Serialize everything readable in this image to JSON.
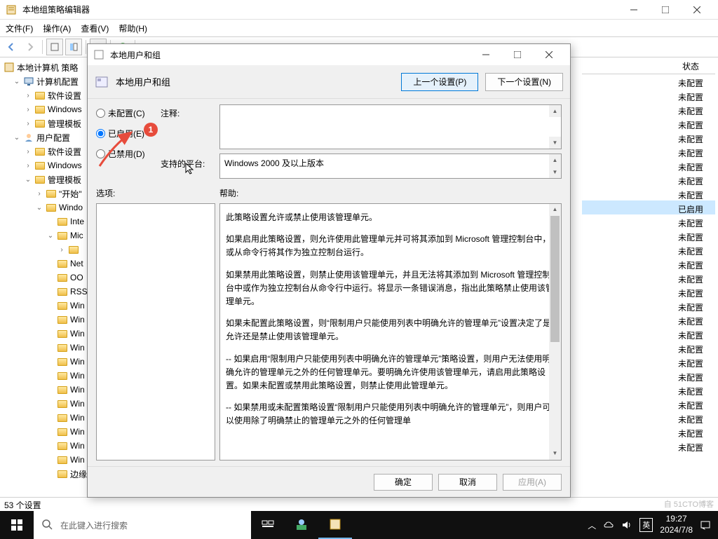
{
  "mainWindow": {
    "title": "本地组策略编辑器",
    "menus": [
      "文件(F)",
      "操作(A)",
      "查看(V)",
      "帮助(H)"
    ]
  },
  "tree": {
    "root": "本地计算机 策略",
    "items": [
      {
        "ind": 1,
        "toggle": "v",
        "icon": "computer",
        "label": "计算机配置"
      },
      {
        "ind": 2,
        "toggle": ">",
        "icon": "folder",
        "label": "软件设置"
      },
      {
        "ind": 2,
        "toggle": ">",
        "icon": "folder",
        "label": "Windows"
      },
      {
        "ind": 2,
        "toggle": ">",
        "icon": "folder",
        "label": "管理模板"
      },
      {
        "ind": 1,
        "toggle": "v",
        "icon": "user",
        "label": "用户配置"
      },
      {
        "ind": 2,
        "toggle": ">",
        "icon": "folder",
        "label": "软件设置"
      },
      {
        "ind": 2,
        "toggle": ">",
        "icon": "folder",
        "label": "Windows"
      },
      {
        "ind": 2,
        "toggle": "v",
        "icon": "folder",
        "label": "管理模板"
      },
      {
        "ind": 3,
        "toggle": ">",
        "icon": "folder",
        "label": "\"开始\""
      },
      {
        "ind": 3,
        "toggle": "v",
        "icon": "folder",
        "label": "Windo"
      },
      {
        "ind": 4,
        "toggle": "",
        "icon": "folder",
        "label": "Inte"
      },
      {
        "ind": 4,
        "toggle": "v",
        "icon": "folder",
        "label": "Mic"
      },
      {
        "ind": 5,
        "toggle": ">",
        "icon": "folder",
        "label": ""
      },
      {
        "ind": 4,
        "toggle": "",
        "icon": "folder",
        "label": "Net"
      },
      {
        "ind": 4,
        "toggle": "",
        "icon": "folder",
        "label": "OO"
      },
      {
        "ind": 4,
        "toggle": "",
        "icon": "folder",
        "label": "RSS"
      },
      {
        "ind": 4,
        "toggle": "",
        "icon": "folder",
        "label": "Win"
      },
      {
        "ind": 4,
        "toggle": "",
        "icon": "folder",
        "label": "Win"
      },
      {
        "ind": 4,
        "toggle": "",
        "icon": "folder",
        "label": "Win"
      },
      {
        "ind": 4,
        "toggle": "",
        "icon": "folder",
        "label": "Win"
      },
      {
        "ind": 4,
        "toggle": "",
        "icon": "folder",
        "label": "Win"
      },
      {
        "ind": 4,
        "toggle": "",
        "icon": "folder",
        "label": "Win"
      },
      {
        "ind": 4,
        "toggle": "",
        "icon": "folder",
        "label": "Win"
      },
      {
        "ind": 4,
        "toggle": "",
        "icon": "folder",
        "label": "Win"
      },
      {
        "ind": 4,
        "toggle": "",
        "icon": "folder",
        "label": "Win"
      },
      {
        "ind": 4,
        "toggle": "",
        "icon": "folder",
        "label": "Win"
      },
      {
        "ind": 4,
        "toggle": "",
        "icon": "folder",
        "label": "Win"
      },
      {
        "ind": 4,
        "toggle": "",
        "icon": "folder",
        "label": "Win"
      },
      {
        "ind": 4,
        "toggle": "",
        "icon": "folder",
        "label": "边缘"
      }
    ]
  },
  "list": {
    "headerState": "状态",
    "rows": [
      {
        "state": "未配置",
        "sel": false
      },
      {
        "state": "未配置",
        "sel": false
      },
      {
        "state": "未配置",
        "sel": false
      },
      {
        "state": "未配置",
        "sel": false
      },
      {
        "state": "未配置",
        "sel": false
      },
      {
        "state": "未配置",
        "sel": false
      },
      {
        "state": "未配置",
        "sel": false
      },
      {
        "state": "未配置",
        "sel": false
      },
      {
        "state": "未配置",
        "sel": false
      },
      {
        "state": "已启用",
        "sel": true
      },
      {
        "state": "未配置",
        "sel": false
      },
      {
        "state": "未配置",
        "sel": false
      },
      {
        "state": "未配置",
        "sel": false
      },
      {
        "state": "未配置",
        "sel": false
      },
      {
        "state": "未配置",
        "sel": false
      },
      {
        "state": "未配置",
        "sel": false
      },
      {
        "state": "未配置",
        "sel": false
      },
      {
        "state": "未配置",
        "sel": false
      },
      {
        "state": "未配置",
        "sel": false
      },
      {
        "state": "未配置",
        "sel": false
      },
      {
        "state": "未配置",
        "sel": false
      },
      {
        "state": "未配置",
        "sel": false
      },
      {
        "state": "未配置",
        "sel": false
      },
      {
        "state": "未配置",
        "sel": false
      },
      {
        "state": "未配置",
        "sel": false
      },
      {
        "state": "未配置",
        "sel": false
      },
      {
        "state": "未配置",
        "sel": false
      }
    ]
  },
  "statusbar": "53 个设置",
  "dialog": {
    "title": "本地用户和组",
    "headerTitle": "本地用户和组",
    "prevBtn": "上一个设置(P)",
    "nextBtn": "下一个设置(N)",
    "radioNotConfigured": "未配置(C)",
    "radioEnabled": "已启用(E)",
    "radioDisabled": "已禁用(D)",
    "lblComment": "注释:",
    "lblPlatform": "支持的平台:",
    "platformText": "Windows 2000 及以上版本",
    "lblOptions": "选项:",
    "lblHelp": "帮助:",
    "helpParas": [
      "此策略设置允许或禁止使用该管理单元。",
      "如果启用此策略设置，则允许使用此管理单元并可将其添加到 Microsoft 管理控制台中，或从命令行将其作为独立控制台运行。",
      "如果禁用此策略设置，则禁止使用该管理单元，并且无法将其添加到 Microsoft 管理控制台中或作为独立控制台从命令行中运行。将显示一条错误消息，指出此策略禁止使用该管理单元。",
      "如果未配置此策略设置，则“限制用户只能使用列表中明确允许的管理单元”设置决定了是允许还是禁止使用该管理单元。",
      "-- 如果启用“限制用户只能使用列表中明确允许的管理单元”策略设置，则用户无法使用明确允许的管理单元之外的任何管理单元。要明确允许使用该管理单元，请启用此策略设置。如果未配置或禁用此策略设置，则禁止使用此管理单元。",
      "-- 如果禁用或未配置策略设置“限制用户只能使用列表中明确允许的管理单元”，则用户可以使用除了明确禁止的管理单元之外的任何管理单"
    ],
    "btnOk": "确定",
    "btnCancel": "取消",
    "btnApply": "应用(A)"
  },
  "annotation": {
    "badge": "1"
  },
  "taskbar": {
    "searchPlaceholder": "在此键入进行搜索",
    "time": "19:27",
    "date": "2024/7/8",
    "lang": "英"
  },
  "watermark": "自 51CTO博客"
}
